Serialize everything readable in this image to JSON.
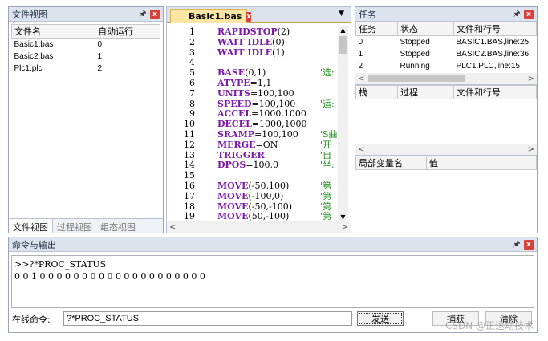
{
  "file_panel": {
    "title": "文件视图",
    "columns": [
      "文件名",
      "自动运行"
    ],
    "rows": [
      {
        "name": "Basic1.bas",
        "auto": "0"
      },
      {
        "name": "Basic2.bas",
        "auto": "1"
      },
      {
        "name": "Plc1.plc",
        "auto": "2"
      }
    ],
    "tabs": [
      "文件视图",
      "过程视图",
      "组态视图"
    ]
  },
  "editor": {
    "tab_label": "Basic1.bas",
    "dropdown": "▼",
    "lines": [
      {
        "n": "1",
        "code": "RAPIDSTOP(2)",
        "kw": "RAPIDSTOP",
        "rest": "(2)",
        "comment": ""
      },
      {
        "n": "2",
        "code": "WAIT IDLE(0)",
        "kw": "WAIT IDLE",
        "rest": "(0)",
        "comment": ""
      },
      {
        "n": "3",
        "code": "WAIT IDLE(1)",
        "kw": "WAIT IDLE",
        "rest": "(1)",
        "comment": ""
      },
      {
        "n": "4",
        "code": "",
        "kw": "",
        "rest": "",
        "comment": ""
      },
      {
        "n": "5",
        "code": "BASE(0,1)",
        "kw": "BASE",
        "rest": "(0,1)",
        "comment": "'选:"
      },
      {
        "n": "6",
        "code": "ATYPE=1,1",
        "kw": "ATYPE",
        "rest": "=1,1",
        "comment": ""
      },
      {
        "n": "7",
        "code": "UNITS=100,100",
        "kw": "UNITS",
        "rest": "=100,100",
        "comment": ""
      },
      {
        "n": "8",
        "code": "SPEED=100,100",
        "kw": "SPEED",
        "rest": "=100,100",
        "comment": "'运:"
      },
      {
        "n": "9",
        "code": "ACCEL=1000,1000",
        "kw": "ACCEL",
        "rest": "=1000,1000",
        "comment": ""
      },
      {
        "n": "10",
        "code": "DECEL=1000,1000",
        "kw": "DECEL",
        "rest": "=1000,1000",
        "comment": ""
      },
      {
        "n": "11",
        "code": "SRAMP=100,100",
        "kw": "SRAMP",
        "rest": "=100,100",
        "comment": "'S曲"
      },
      {
        "n": "12",
        "code": "MERGE=ON",
        "kw": "MERGE",
        "rest": "=ON",
        "comment": "'开"
      },
      {
        "n": "13",
        "code": "TRIGGER",
        "kw": "TRIGGER",
        "rest": "",
        "comment": "'自"
      },
      {
        "n": "14",
        "code": "DPOS=100,0",
        "kw": "DPOS",
        "rest": "=100,0",
        "comment": "'坐:"
      },
      {
        "n": "15",
        "code": "",
        "kw": "",
        "rest": "",
        "comment": ""
      },
      {
        "n": "16",
        "code": "MOVE(-50,100)",
        "kw": "MOVE",
        "rest": "(-50,100)",
        "comment": "'第"
      },
      {
        "n": "17",
        "code": "MOVE(-100,0)",
        "kw": "MOVE",
        "rest": "(-100,0)",
        "comment": "'第"
      },
      {
        "n": "18",
        "code": "MOVE(-50,-100)",
        "kw": "MOVE",
        "rest": "(-50,-100)",
        "comment": "'第"
      },
      {
        "n": "19",
        "code": "MOVE(50,-100)",
        "kw": "MOVE",
        "rest": "(50,-100)",
        "comment": "'第"
      }
    ]
  },
  "task_panel": {
    "title": "任务",
    "columns": [
      "任务",
      "状态",
      "文件和行号"
    ],
    "rows": [
      {
        "id": "0",
        "status": "Stopped",
        "file": "BASIC1.BAS,line:25"
      },
      {
        "id": "1",
        "status": "Stopped",
        "file": "BASIC2.BAS,line:36"
      },
      {
        "id": "2",
        "status": "Running",
        "file": "PLC1.PLC,line:15"
      }
    ],
    "stack_columns": [
      "栈",
      "过程",
      "文件和行号"
    ],
    "local_columns": [
      "局部变量名",
      "值"
    ]
  },
  "command_panel": {
    "title": "命令与输出",
    "output_lines": [
      ">>?*PROC_STATUS",
      "0 0 1 0 0 0 0 0 0 0 0 0 0 0 0 0 0 0 0 0 0 0 0"
    ],
    "input_label": "在线命令:",
    "input_value": "?*PROC_STATUS",
    "send_label": "发送",
    "capture_label": "捕获",
    "clear_label": "清除",
    "watermark": "CSDN @正运动技术"
  },
  "icons": {
    "pin": "pin-icon",
    "close": "close-icon"
  },
  "colors": {
    "keyword": "#7b18a8",
    "comment": "#1f8a1f",
    "close": "#d9413b",
    "titlebar": "#dde3ec"
  }
}
